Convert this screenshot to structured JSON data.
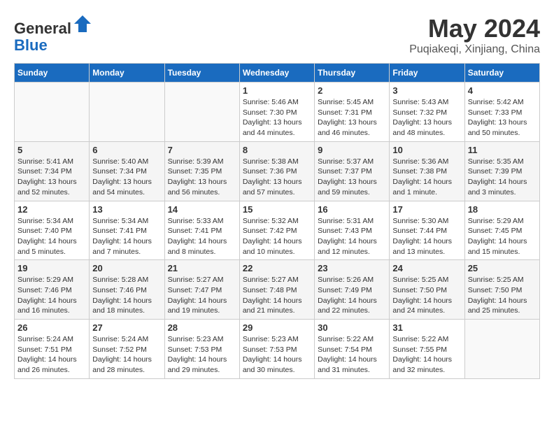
{
  "header": {
    "logo_line1": "General",
    "logo_line2": "Blue",
    "main_title": "May 2024",
    "sub_title": "Puqiakeqi, Xinjiang, China"
  },
  "weekdays": [
    "Sunday",
    "Monday",
    "Tuesday",
    "Wednesday",
    "Thursday",
    "Friday",
    "Saturday"
  ],
  "weeks": [
    [
      {
        "day": "",
        "info": ""
      },
      {
        "day": "",
        "info": ""
      },
      {
        "day": "",
        "info": ""
      },
      {
        "day": "1",
        "info": "Sunrise: 5:46 AM\nSunset: 7:30 PM\nDaylight: 13 hours\nand 44 minutes."
      },
      {
        "day": "2",
        "info": "Sunrise: 5:45 AM\nSunset: 7:31 PM\nDaylight: 13 hours\nand 46 minutes."
      },
      {
        "day": "3",
        "info": "Sunrise: 5:43 AM\nSunset: 7:32 PM\nDaylight: 13 hours\nand 48 minutes."
      },
      {
        "day": "4",
        "info": "Sunrise: 5:42 AM\nSunset: 7:33 PM\nDaylight: 13 hours\nand 50 minutes."
      }
    ],
    [
      {
        "day": "5",
        "info": "Sunrise: 5:41 AM\nSunset: 7:34 PM\nDaylight: 13 hours\nand 52 minutes."
      },
      {
        "day": "6",
        "info": "Sunrise: 5:40 AM\nSunset: 7:34 PM\nDaylight: 13 hours\nand 54 minutes."
      },
      {
        "day": "7",
        "info": "Sunrise: 5:39 AM\nSunset: 7:35 PM\nDaylight: 13 hours\nand 56 minutes."
      },
      {
        "day": "8",
        "info": "Sunrise: 5:38 AM\nSunset: 7:36 PM\nDaylight: 13 hours\nand 57 minutes."
      },
      {
        "day": "9",
        "info": "Sunrise: 5:37 AM\nSunset: 7:37 PM\nDaylight: 13 hours\nand 59 minutes."
      },
      {
        "day": "10",
        "info": "Sunrise: 5:36 AM\nSunset: 7:38 PM\nDaylight: 14 hours\nand 1 minute."
      },
      {
        "day": "11",
        "info": "Sunrise: 5:35 AM\nSunset: 7:39 PM\nDaylight: 14 hours\nand 3 minutes."
      }
    ],
    [
      {
        "day": "12",
        "info": "Sunrise: 5:34 AM\nSunset: 7:40 PM\nDaylight: 14 hours\nand 5 minutes."
      },
      {
        "day": "13",
        "info": "Sunrise: 5:34 AM\nSunset: 7:41 PM\nDaylight: 14 hours\nand 7 minutes."
      },
      {
        "day": "14",
        "info": "Sunrise: 5:33 AM\nSunset: 7:41 PM\nDaylight: 14 hours\nand 8 minutes."
      },
      {
        "day": "15",
        "info": "Sunrise: 5:32 AM\nSunset: 7:42 PM\nDaylight: 14 hours\nand 10 minutes."
      },
      {
        "day": "16",
        "info": "Sunrise: 5:31 AM\nSunset: 7:43 PM\nDaylight: 14 hours\nand 12 minutes."
      },
      {
        "day": "17",
        "info": "Sunrise: 5:30 AM\nSunset: 7:44 PM\nDaylight: 14 hours\nand 13 minutes."
      },
      {
        "day": "18",
        "info": "Sunrise: 5:29 AM\nSunset: 7:45 PM\nDaylight: 14 hours\nand 15 minutes."
      }
    ],
    [
      {
        "day": "19",
        "info": "Sunrise: 5:29 AM\nSunset: 7:46 PM\nDaylight: 14 hours\nand 16 minutes."
      },
      {
        "day": "20",
        "info": "Sunrise: 5:28 AM\nSunset: 7:46 PM\nDaylight: 14 hours\nand 18 minutes."
      },
      {
        "day": "21",
        "info": "Sunrise: 5:27 AM\nSunset: 7:47 PM\nDaylight: 14 hours\nand 19 minutes."
      },
      {
        "day": "22",
        "info": "Sunrise: 5:27 AM\nSunset: 7:48 PM\nDaylight: 14 hours\nand 21 minutes."
      },
      {
        "day": "23",
        "info": "Sunrise: 5:26 AM\nSunset: 7:49 PM\nDaylight: 14 hours\nand 22 minutes."
      },
      {
        "day": "24",
        "info": "Sunrise: 5:25 AM\nSunset: 7:50 PM\nDaylight: 14 hours\nand 24 minutes."
      },
      {
        "day": "25",
        "info": "Sunrise: 5:25 AM\nSunset: 7:50 PM\nDaylight: 14 hours\nand 25 minutes."
      }
    ],
    [
      {
        "day": "26",
        "info": "Sunrise: 5:24 AM\nSunset: 7:51 PM\nDaylight: 14 hours\nand 26 minutes."
      },
      {
        "day": "27",
        "info": "Sunrise: 5:24 AM\nSunset: 7:52 PM\nDaylight: 14 hours\nand 28 minutes."
      },
      {
        "day": "28",
        "info": "Sunrise: 5:23 AM\nSunset: 7:53 PM\nDaylight: 14 hours\nand 29 minutes."
      },
      {
        "day": "29",
        "info": "Sunrise: 5:23 AM\nSunset: 7:53 PM\nDaylight: 14 hours\nand 30 minutes."
      },
      {
        "day": "30",
        "info": "Sunrise: 5:22 AM\nSunset: 7:54 PM\nDaylight: 14 hours\nand 31 minutes."
      },
      {
        "day": "31",
        "info": "Sunrise: 5:22 AM\nSunset: 7:55 PM\nDaylight: 14 hours\nand 32 minutes."
      },
      {
        "day": "",
        "info": ""
      }
    ]
  ]
}
